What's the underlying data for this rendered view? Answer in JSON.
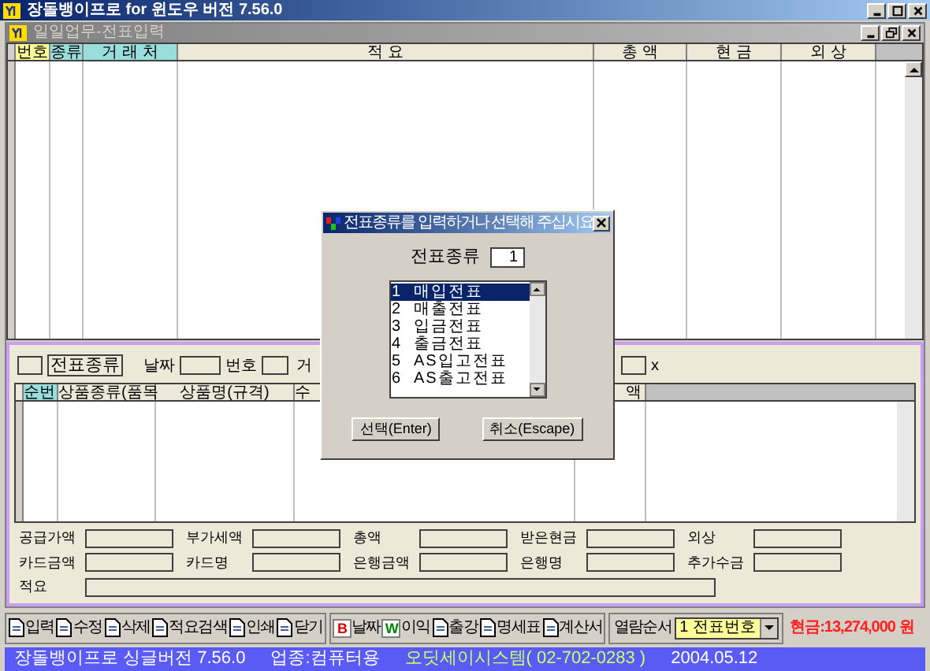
{
  "window": {
    "title": "장돌뱅이프로 for 윈도우 버전 7.56.0"
  },
  "child_window": {
    "title": "일일업무-전표입력"
  },
  "voucher_table": {
    "columns": [
      {
        "label": "번호",
        "color": "#ffff99"
      },
      {
        "label": "종류",
        "color": "#99dddd"
      },
      {
        "label": "거 래 처",
        "color": "#99dddd"
      },
      {
        "label": "적 요",
        "color": "#ece9d8"
      },
      {
        "label": "총 액",
        "color": "#ece9d8"
      },
      {
        "label": "현 금",
        "color": "#ece9d8"
      },
      {
        "label": "외 상",
        "color": "#ece9d8"
      }
    ]
  },
  "entry_form": {
    "labels": [
      "전표종류",
      "날짜",
      "번호",
      "거",
      "x"
    ]
  },
  "detail_table": {
    "columns": [
      "순번",
      "상품종류(품목",
      "상품명(규격)",
      "수",
      "액"
    ]
  },
  "totals": [
    [
      {
        "label": "공급가액"
      },
      {
        "label": "부가세액"
      },
      {
        "label": "총액"
      },
      {
        "label": "받은현금"
      },
      {
        "label": "외상"
      }
    ],
    [
      {
        "label": "카드금액"
      },
      {
        "label": "카드명"
      },
      {
        "label": "은행금액"
      },
      {
        "label": "은행명"
      },
      {
        "label": "추가수금"
      }
    ]
  ],
  "memo": {
    "label": "적요"
  },
  "toolbar": [
    [
      {
        "label": "입력"
      },
      {
        "label": "수정"
      },
      {
        "label": "삭제"
      },
      {
        "label": "적요검색"
      },
      {
        "label": "인쇄"
      },
      {
        "label": "닫기"
      }
    ],
    [
      {
        "label": "날짜",
        "glyph": "B",
        "color": "#dd0000"
      },
      {
        "label": "이익",
        "glyph": "W",
        "color": "#008800"
      },
      {
        "label": "출강"
      },
      {
        "label": "명세표"
      },
      {
        "label": "계산서"
      }
    ]
  ],
  "sort": {
    "label": "열람순서",
    "value": "1 전표번호"
  },
  "cash_total": "현금:13,274,000 원",
  "status_bar": [
    {
      "text": "장돌뱅이프로 싱글버전 7.56.0",
      "color": "#ffffff"
    },
    {
      "text": "업종:컴퓨터용",
      "color": "#ffffff"
    },
    {
      "text": "오딧세이시스템( 02-702-0283 )",
      "color": "#ccff66"
    },
    {
      "text": "2004.05.12",
      "color": "#ffffff"
    }
  ],
  "dialog": {
    "title": "전표종류를 입력하거나 선택해 주십시요",
    "field_label": "전표종류",
    "field_value": "1",
    "items": [
      {
        "number": "1",
        "label": "매입전표",
        "selected": true
      },
      {
        "number": "2",
        "label": "매출전표",
        "selected": false
      },
      {
        "number": "3",
        "label": "입금전표",
        "selected": false
      },
      {
        "number": "4",
        "label": "출금전표",
        "selected": false
      },
      {
        "number": "5",
        "label": "AS입고전표",
        "selected": false
      },
      {
        "number": "6",
        "label": "AS출고전표",
        "selected": false
      }
    ],
    "buttons": [
      "선택(Enter)",
      "취소(Escape)"
    ]
  }
}
